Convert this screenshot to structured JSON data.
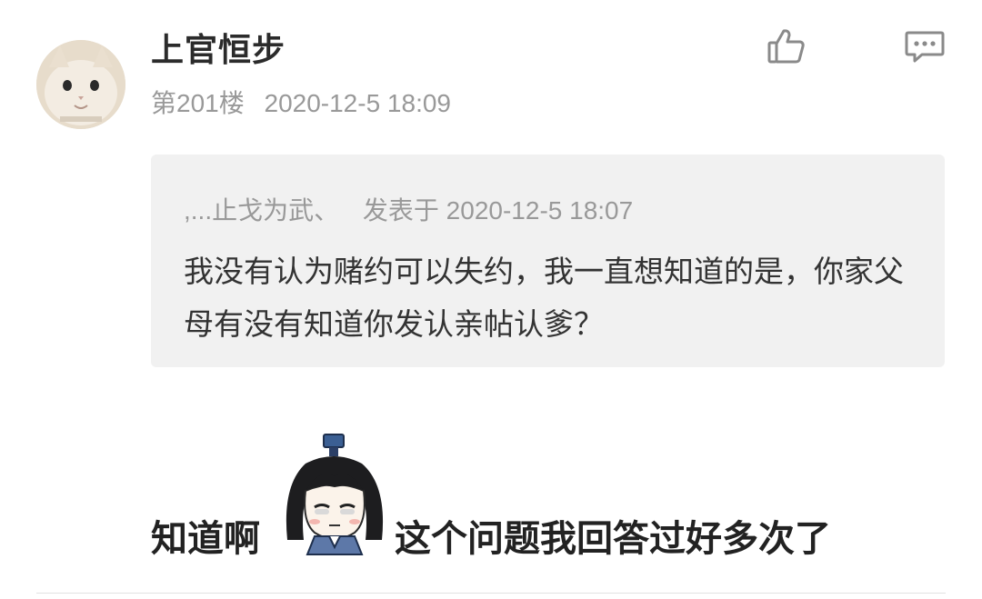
{
  "post": {
    "username": "上官恒步",
    "floor": "第201楼",
    "timestamp": "2020-12-5 18:09",
    "avatar_icon": "cat-avatar",
    "like_icon": "thumbs-up-icon",
    "comment_icon": "comment-icon"
  },
  "quote": {
    "author": ",...止戈为武、",
    "posted_at_label": "发表于 2020-12-5 18:07",
    "text": "我没有认为赌约可以失约，我一直想知道的是，你家父母有没有知道你发认亲帖认爹？"
  },
  "reply": {
    "text_before": "知道啊",
    "sticker_icon": "anime-character-sticker",
    "text_after": "这个问题我回答过好多次了"
  },
  "colors": {
    "username": "#2b2b2b",
    "meta": "#999999",
    "quote_bg": "#f1f1f1",
    "icon": "#8a8a8a"
  }
}
